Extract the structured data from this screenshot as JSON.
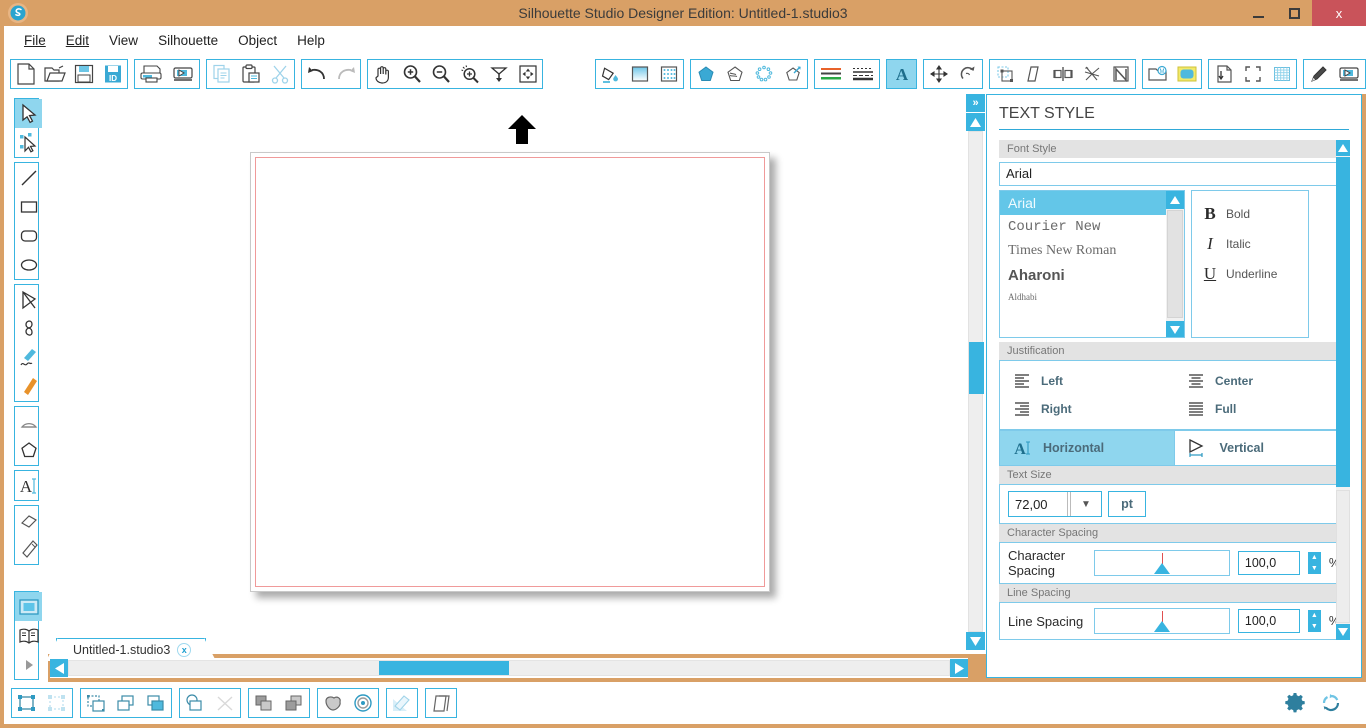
{
  "window": {
    "title": "Silhouette Studio Designer Edition: Untitled-1.studio3",
    "logo_icon": "silhouette-logo-icon",
    "minimize_label": "",
    "maximize_label": "",
    "close_label": "x",
    "titlebar_color": "#d9a066",
    "close_color": "#c9535a",
    "accent_color": "#38b4e0"
  },
  "menubar": {
    "items": [
      {
        "label": "File",
        "accel": "F"
      },
      {
        "label": "Edit",
        "accel": "E"
      },
      {
        "label": "View",
        "accel": ""
      },
      {
        "label": "Silhouette",
        "accel": ""
      },
      {
        "label": "Object",
        "accel": ""
      },
      {
        "label": "Help",
        "accel": ""
      }
    ]
  },
  "toolbar": {
    "groups": [
      {
        "name": "file-group",
        "buttons": [
          {
            "icon": "new-document-icon",
            "label": "New"
          },
          {
            "icon": "open-folder-icon",
            "label": "Open"
          },
          {
            "icon": "save-disk-icon",
            "label": "Save"
          },
          {
            "icon": "save-library-icon",
            "label": "Save to Library"
          }
        ]
      },
      {
        "name": "print-group",
        "buttons": [
          {
            "icon": "print-icon",
            "label": "Print"
          },
          {
            "icon": "send-to-silhouette-icon",
            "label": "Send to Silhouette"
          }
        ]
      },
      {
        "name": "clipboard-group",
        "buttons": [
          {
            "icon": "copy-icon",
            "label": "Copy"
          },
          {
            "icon": "paste-icon",
            "label": "Paste"
          },
          {
            "icon": "cut-scissors-icon",
            "label": "Cut"
          }
        ]
      },
      {
        "name": "history-group",
        "buttons": [
          {
            "icon": "undo-arrow-icon",
            "label": "Undo"
          },
          {
            "icon": "redo-arrow-icon",
            "label": "Redo"
          }
        ]
      },
      {
        "name": "view-group",
        "buttons": [
          {
            "icon": "pan-hand-icon",
            "label": "Pan"
          },
          {
            "icon": "zoom-in-icon",
            "label": "Zoom In"
          },
          {
            "icon": "zoom-out-icon",
            "label": "Zoom Out"
          },
          {
            "icon": "zoom-selection-icon",
            "label": "Zoom to Selection"
          },
          {
            "icon": "fit-to-page-icon",
            "label": "Fit to Page"
          },
          {
            "icon": "fit-to-window-icon",
            "label": "Fit to Window"
          }
        ]
      },
      {
        "name": "fill-group",
        "buttons": [
          {
            "icon": "fill-color-icon",
            "label": "Fill Color"
          },
          {
            "icon": "fill-gradient-icon",
            "label": "Gradient Fill"
          },
          {
            "icon": "fill-pattern-icon",
            "label": "Pattern Fill"
          }
        ]
      },
      {
        "name": "shape-style-group",
        "buttons": [
          {
            "icon": "shape-solid-icon",
            "label": "Line Color"
          },
          {
            "icon": "shape-shadow-icon",
            "label": "Shadow"
          },
          {
            "icon": "shape-dots-icon",
            "label": "Rhinestones"
          },
          {
            "icon": "shape-sketch-icon",
            "label": "Sketch"
          }
        ]
      },
      {
        "name": "line-group",
        "buttons": [
          {
            "icon": "line-color-icon",
            "label": "Line Color"
          },
          {
            "icon": "line-style-icon",
            "label": "Line Style"
          }
        ]
      },
      {
        "name": "text-group",
        "buttons": [
          {
            "icon": "text-style-A-icon",
            "label": "Text Style",
            "active": true
          }
        ]
      },
      {
        "name": "transform-group",
        "buttons": [
          {
            "icon": "move-transform-icon",
            "label": "Move"
          },
          {
            "icon": "rotate-icon",
            "label": "Rotate"
          }
        ]
      },
      {
        "name": "modify-group",
        "buttons": [
          {
            "icon": "scale-icon",
            "label": "Scale"
          },
          {
            "icon": "shear-icon",
            "label": "Shear"
          },
          {
            "icon": "align-icon",
            "label": "Align"
          },
          {
            "icon": "replicate-icon",
            "label": "Replicate"
          },
          {
            "icon": "nesting-icon",
            "label": "Nesting"
          }
        ]
      },
      {
        "name": "library-group",
        "buttons": [
          {
            "icon": "my-library-icon",
            "label": "My Library"
          },
          {
            "icon": "store-icon",
            "label": "Silhouette Store"
          }
        ]
      },
      {
        "name": "page-group",
        "buttons": [
          {
            "icon": "page-setup-icon",
            "label": "Page Setup"
          },
          {
            "icon": "registration-marks-icon",
            "label": "Registration Marks"
          },
          {
            "icon": "grid-icon",
            "label": "Grid"
          }
        ]
      },
      {
        "name": "cut-group",
        "buttons": [
          {
            "icon": "cut-settings-pen-icon",
            "label": "Cut Settings"
          },
          {
            "icon": "send-to-cutter-icon",
            "label": "Send"
          }
        ]
      }
    ]
  },
  "left_tools": {
    "groups": [
      {
        "name": "select-group",
        "buttons": [
          {
            "icon": "select-arrow-icon",
            "label": "Select",
            "active": true
          },
          {
            "icon": "edit-points-icon",
            "label": "Edit Points"
          }
        ]
      },
      {
        "name": "shapes-group",
        "buttons": [
          {
            "icon": "line-tool-icon",
            "label": "Draw a Line"
          },
          {
            "icon": "rectangle-tool-icon",
            "label": "Draw a Rectangle"
          },
          {
            "icon": "rounded-rectangle-tool-icon",
            "label": "Draw a Rounded Rectangle"
          },
          {
            "icon": "ellipse-tool-icon",
            "label": "Draw an Ellipse"
          }
        ]
      },
      {
        "name": "draw-group",
        "buttons": [
          {
            "icon": "polygon-tool-icon",
            "label": "Draw a Polygon"
          },
          {
            "icon": "curve-tool-icon",
            "label": "Draw a Curve Shape"
          },
          {
            "icon": "freehand-tool-icon",
            "label": "Draw Freehand"
          },
          {
            "icon": "smooth-freehand-tool-icon",
            "label": "Draw Smooth Freehand"
          }
        ]
      },
      {
        "name": "arc-group",
        "buttons": [
          {
            "icon": "arc-tool-icon",
            "label": "Draw an Arc"
          },
          {
            "icon": "regular-polygon-tool-icon",
            "label": "Draw a Regular Polygon"
          }
        ]
      },
      {
        "name": "text-group",
        "buttons": [
          {
            "icon": "text-tool-icon",
            "label": "Draw a Text"
          }
        ]
      },
      {
        "name": "erase-group",
        "buttons": [
          {
            "icon": "eraser-tool-icon",
            "label": "Eraser"
          },
          {
            "icon": "knife-tool-icon",
            "label": "Knife"
          }
        ]
      },
      {
        "name": "panel-group",
        "buttons": [
          {
            "icon": "design-page-icon",
            "label": "Design Page",
            "active": true
          },
          {
            "icon": "library-book-icon",
            "label": "Library"
          },
          {
            "icon": "send-panel-icon",
            "label": "Send"
          }
        ]
      }
    ]
  },
  "canvas": {
    "feed_arrow_icon": "page-feed-arrow-icon",
    "page_border_color": "#f09a9a",
    "vertical_scroll": {
      "expand_icon": "expand-panel-chevrons-icon",
      "expand_label": "»",
      "up_icon": "scroll-up-arrow-icon",
      "down_icon": "scroll-down-arrow-icon"
    },
    "horizontal_scroll": {
      "left_icon": "scroll-left-arrow-icon",
      "right_icon": "scroll-right-arrow-icon"
    }
  },
  "document_tab": {
    "label": "Untitled-1.studio3",
    "close_label": "x",
    "close_icon": "tab-close-icon"
  },
  "text_style_panel": {
    "title": "TEXT STYLE",
    "font_style": {
      "section_label": "Font Style",
      "input_value": "Arial",
      "fonts": [
        {
          "name": "Arial",
          "selected": true
        },
        {
          "name": "Courier New",
          "selected": false
        },
        {
          "name": "Times New Roman",
          "selected": false
        },
        {
          "name": "Aharoni",
          "selected": false
        },
        {
          "name": "Aldhabi",
          "selected": false
        }
      ],
      "styles": [
        {
          "glyph": "B",
          "label": "Bold",
          "icon": "bold-icon"
        },
        {
          "glyph": "I",
          "label": "Italic",
          "icon": "italic-icon"
        },
        {
          "glyph": "U",
          "label": "Underline",
          "icon": "underline-icon"
        }
      ],
      "scroll_up_icon": "scroll-up-arrow-icon",
      "scroll_down_icon": "scroll-down-arrow-icon"
    },
    "justification": {
      "section_label": "Justification",
      "options": [
        {
          "label": "Left",
          "icon": "align-left-icon"
        },
        {
          "label": "Center",
          "icon": "align-center-icon"
        },
        {
          "label": "Right",
          "icon": "align-right-icon"
        },
        {
          "label": "Full",
          "icon": "align-justify-icon"
        }
      ]
    },
    "orientation": {
      "options": [
        {
          "label": "Horizontal",
          "icon": "text-horizontal-icon",
          "active": true
        },
        {
          "label": "Vertical",
          "icon": "text-vertical-icon",
          "active": false
        }
      ]
    },
    "text_size": {
      "section_label": "Text Size",
      "value": "72,00",
      "unit": "pt",
      "dropdown_icon": "chevron-down-icon"
    },
    "character_spacing": {
      "section_label": "Character Spacing",
      "label": "Character Spacing",
      "value": "100,0",
      "unit": "%"
    },
    "line_spacing": {
      "section_label": "Line Spacing",
      "label": "Line Spacing",
      "value": "100,0",
      "unit": "%"
    },
    "panel_scroll": {
      "up_icon": "scroll-up-arrow-icon",
      "down_icon": "scroll-down-arrow-icon"
    }
  },
  "bottom_toolbar": {
    "groups": [
      {
        "name": "group-ungroup",
        "buttons": [
          {
            "icon": "group-icon",
            "label": "Group"
          },
          {
            "icon": "ungroup-icon",
            "label": "Ungroup"
          }
        ]
      },
      {
        "name": "arrange-group",
        "buttons": [
          {
            "icon": "make-compound-path-icon",
            "label": "Make Compound Path"
          },
          {
            "icon": "bring-to-front-icon",
            "label": "Bring to Front"
          },
          {
            "icon": "send-to-back-icon",
            "label": "Send to Back"
          }
        ]
      },
      {
        "name": "weld-group",
        "buttons": [
          {
            "icon": "weld-icon",
            "label": "Weld"
          },
          {
            "icon": "release-compound-icon",
            "label": "Release Compound Path"
          }
        ]
      },
      {
        "name": "order-group",
        "buttons": [
          {
            "icon": "raise-icon",
            "label": "Raise"
          },
          {
            "icon": "lower-icon",
            "label": "Lower"
          }
        ]
      },
      {
        "name": "offset-group",
        "buttons": [
          {
            "icon": "offset-icon",
            "label": "Offset"
          },
          {
            "icon": "internal-offset-icon",
            "label": "Internal Offset"
          }
        ]
      },
      {
        "name": "trace-group",
        "buttons": [
          {
            "icon": "trace-icon",
            "label": "Trace"
          }
        ]
      },
      {
        "name": "layers-group",
        "buttons": [
          {
            "icon": "layers-icon",
            "label": "Layers"
          }
        ]
      }
    ],
    "right_buttons": [
      {
        "icon": "gear-icon",
        "label": "Preferences"
      },
      {
        "icon": "sync-refresh-icon",
        "label": "Sync"
      }
    ]
  }
}
